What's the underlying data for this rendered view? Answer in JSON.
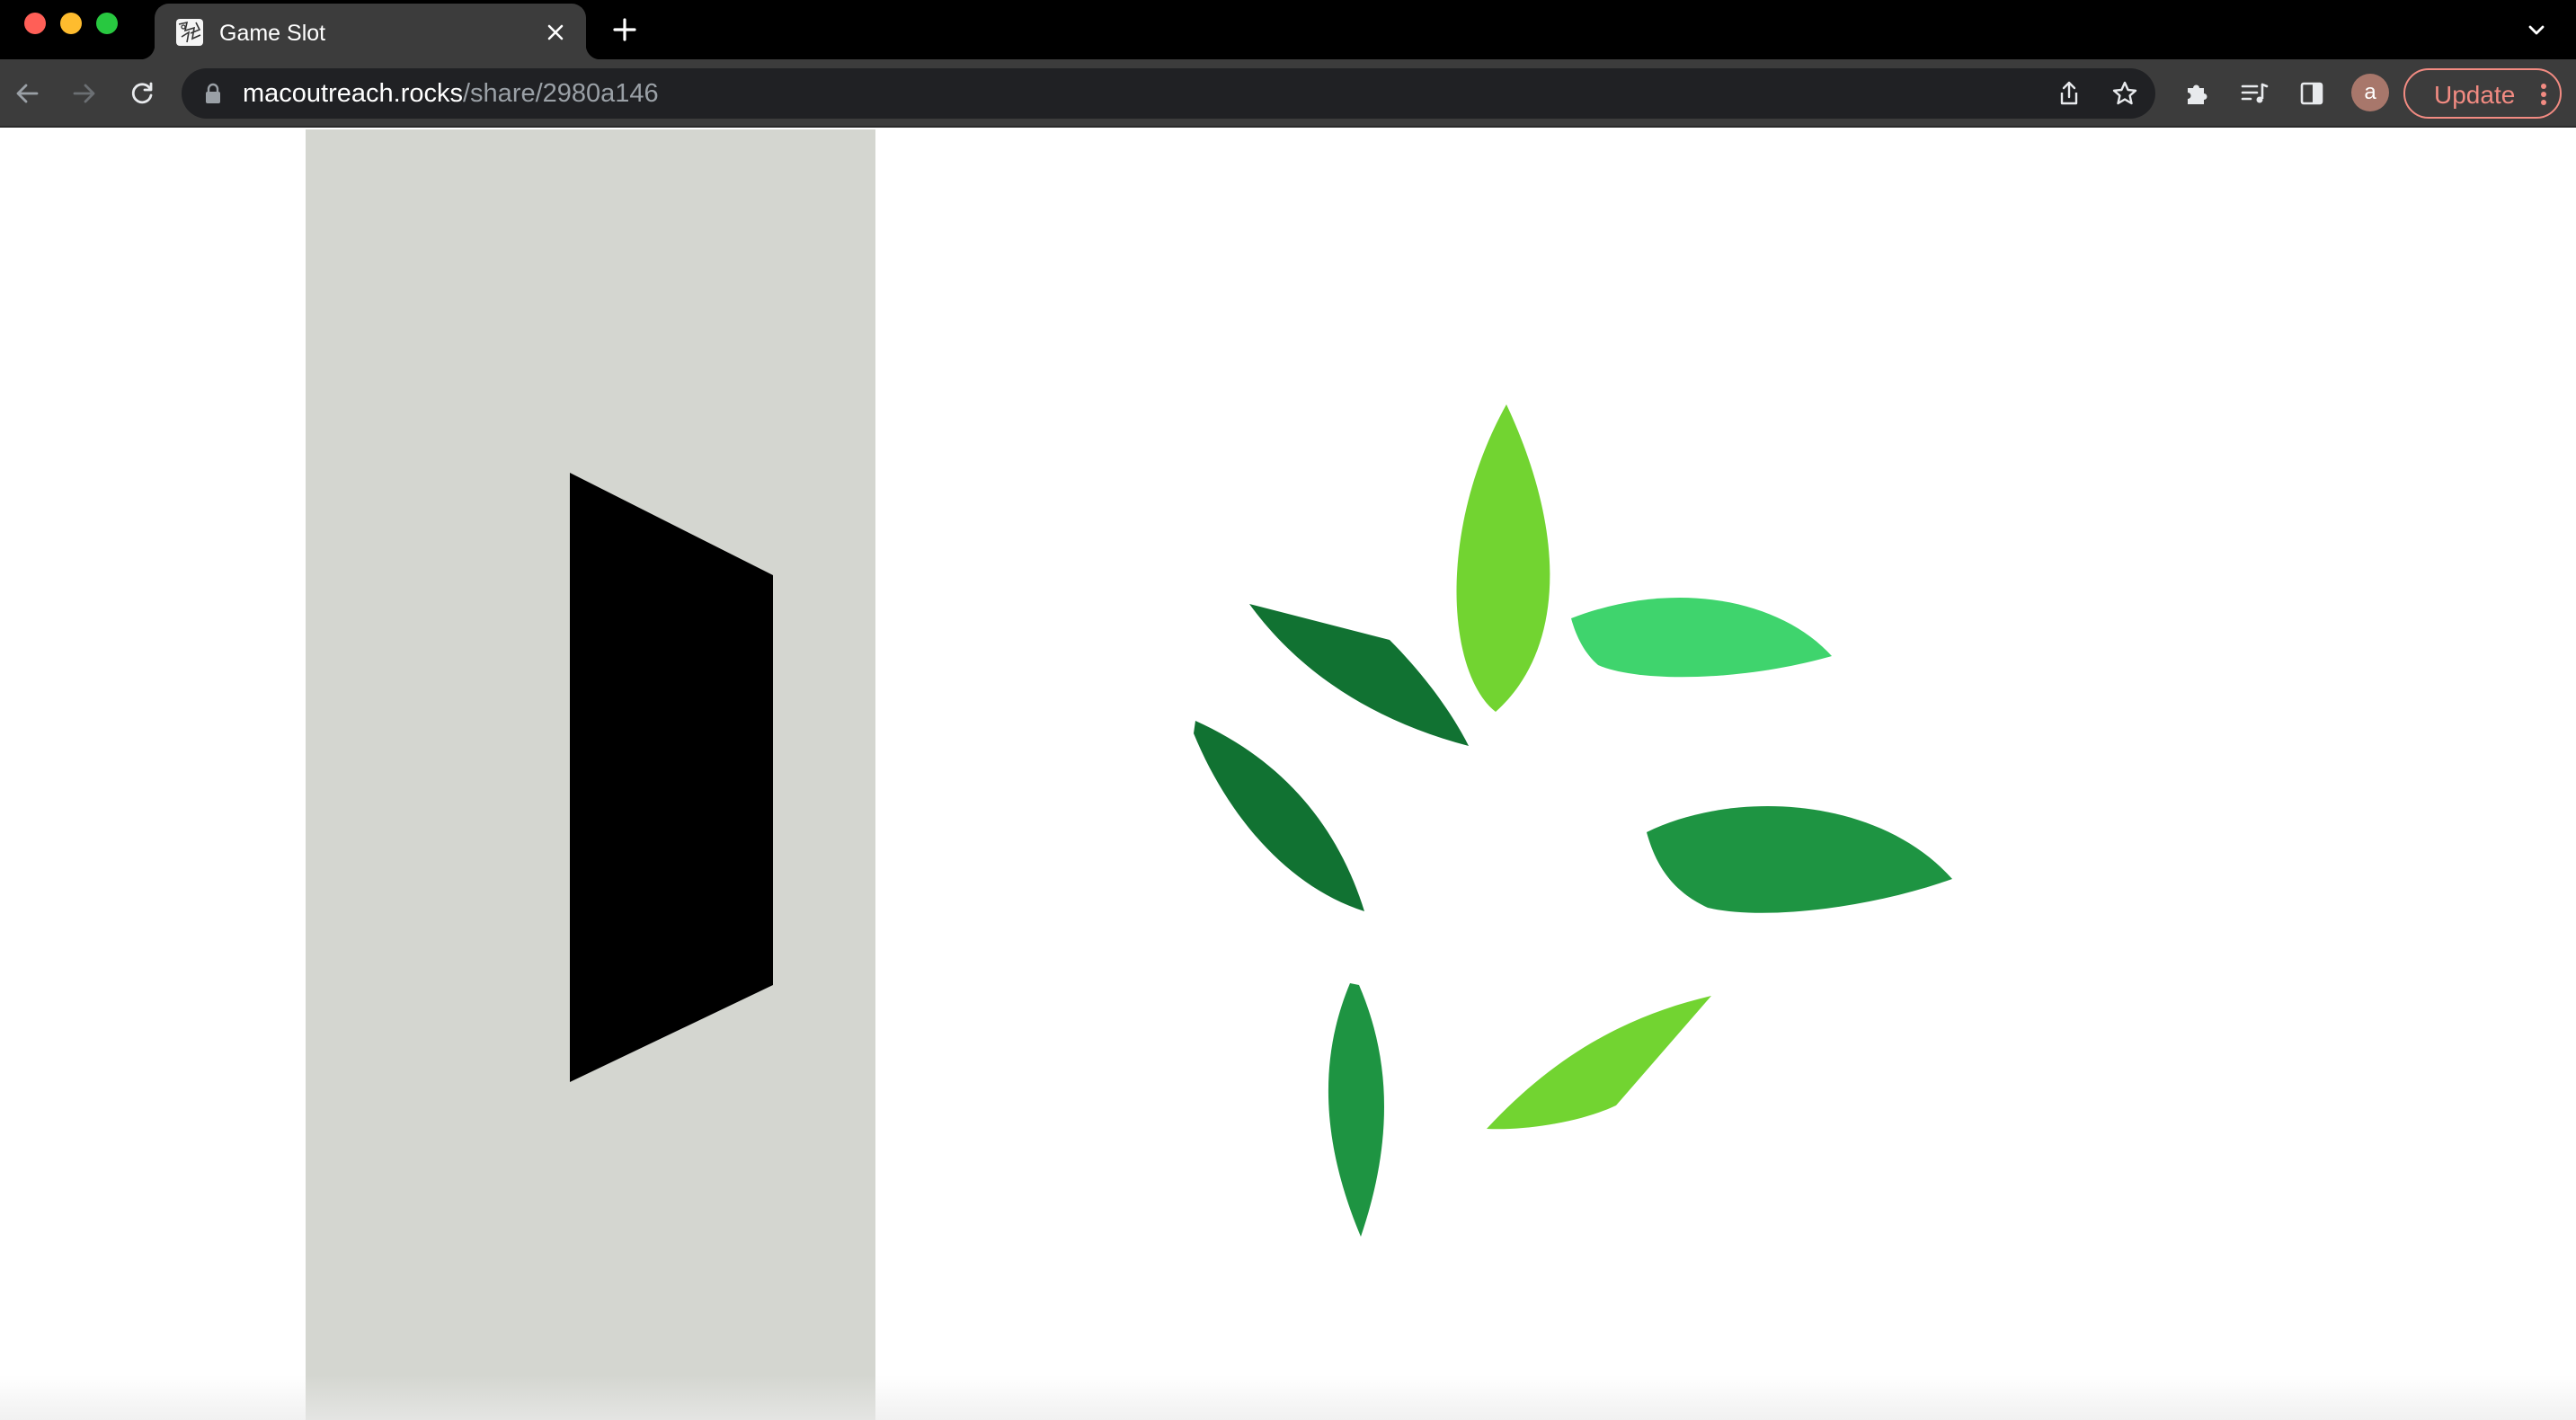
{
  "window": {
    "controls": [
      "close",
      "minimize",
      "zoom"
    ],
    "tab": {
      "title": "Game Slot",
      "favicon": "sketch-favicon"
    }
  },
  "toolbar": {
    "url_host": "macoutreach.rocks",
    "url_path": "/share/2980a146",
    "avatar_letter": "a",
    "update_label": "Update"
  },
  "canvas": {
    "background": "#ffffff",
    "panel_color": "#d4d6d0",
    "door_color": "#000000",
    "leaf_colors": {
      "light_green": "#72d431",
      "mint_green": "#3fd46d",
      "dark_green": "#117232",
      "mid_green": "#1e9442"
    }
  }
}
